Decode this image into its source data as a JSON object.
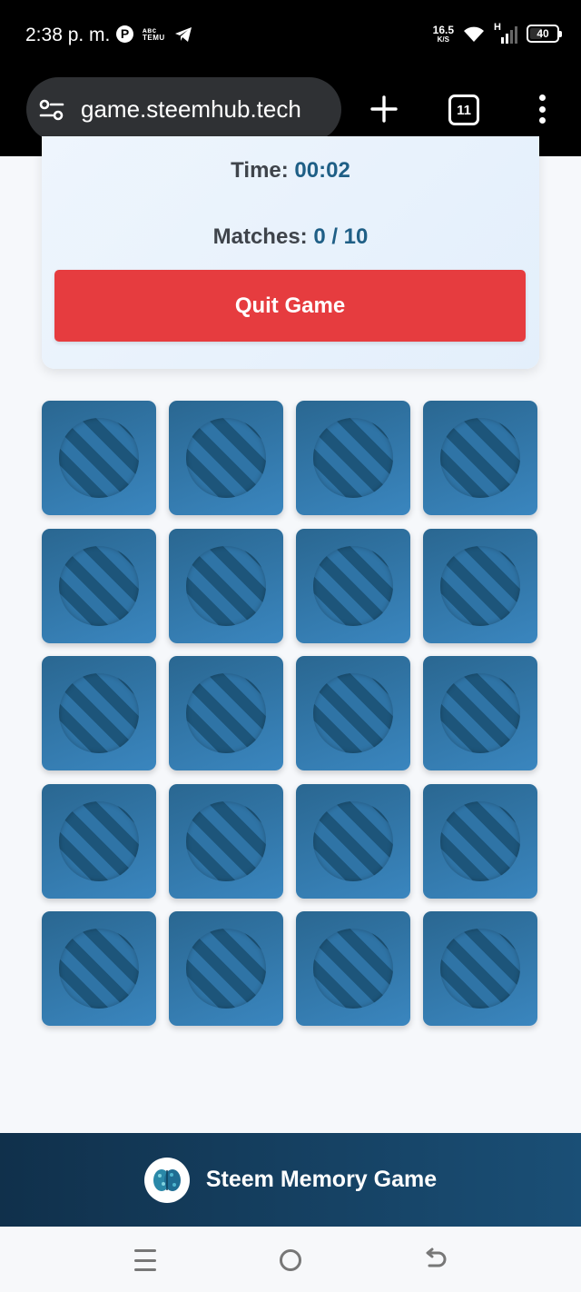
{
  "status_bar": {
    "time": "2:38 p. m.",
    "temu_top": "ᴀʙᴄ",
    "temu_label": "TEMU",
    "net_speed_value": "16.5",
    "net_speed_unit": "K/S",
    "network_type": "H",
    "battery_level": "40"
  },
  "browser": {
    "url": "game.steemhub.tech",
    "tab_count": "11"
  },
  "game": {
    "time_label": "Time:",
    "time_value": "00:02",
    "matches_label": "Matches:",
    "matches_value": "0 / 10",
    "quit_label": "Quit Game",
    "cards": [
      {
        "state": "face-down"
      },
      {
        "state": "face-down"
      },
      {
        "state": "face-down"
      },
      {
        "state": "face-down"
      },
      {
        "state": "face-down"
      },
      {
        "state": "face-down"
      },
      {
        "state": "face-down"
      },
      {
        "state": "face-down"
      },
      {
        "state": "face-down"
      },
      {
        "state": "face-down"
      },
      {
        "state": "face-down"
      },
      {
        "state": "face-down"
      },
      {
        "state": "face-down"
      },
      {
        "state": "face-down"
      },
      {
        "state": "face-down"
      },
      {
        "state": "face-down"
      },
      {
        "state": "face-down"
      },
      {
        "state": "face-down"
      },
      {
        "state": "face-down"
      },
      {
        "state": "face-down"
      }
    ]
  },
  "footer": {
    "title": "Steem Memory Game",
    "logo_icon": "brain-icon"
  },
  "colors": {
    "accent": "#1f5f86",
    "quit": "#e63c3f",
    "card": "#2f74a6",
    "footer": "#10304b"
  }
}
